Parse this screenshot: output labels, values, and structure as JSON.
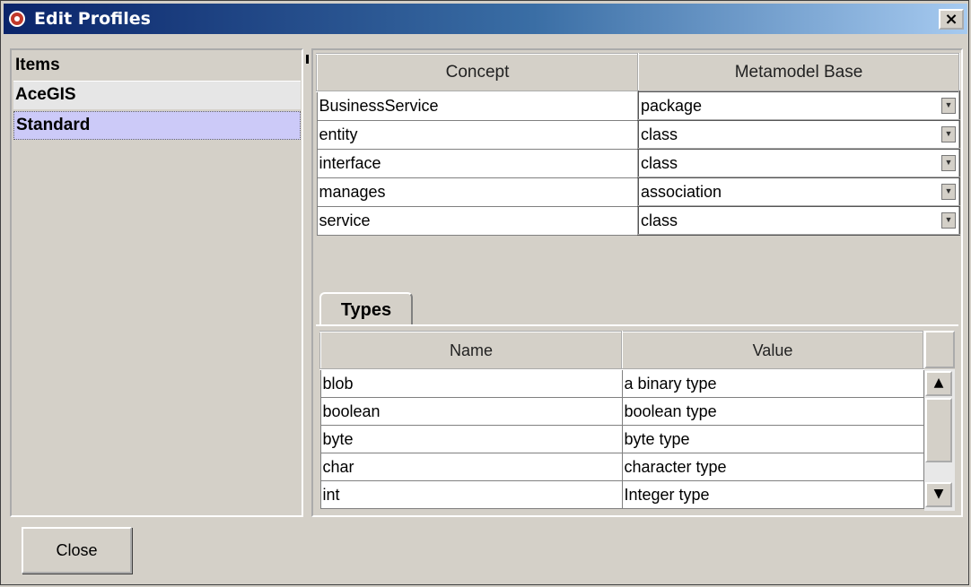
{
  "window": {
    "title": "Edit Profiles",
    "close_glyph": "×"
  },
  "items_panel": {
    "header": "Items",
    "items": [
      {
        "label": "AceGIS"
      },
      {
        "label": "Standard",
        "selected": true
      }
    ]
  },
  "concepts_table": {
    "columns": [
      "Concept",
      "Metamodel Base"
    ],
    "rows": [
      {
        "concept": "BusinessService",
        "base": "package"
      },
      {
        "concept": "entity",
        "base": "class"
      },
      {
        "concept": "interface",
        "base": "class"
      },
      {
        "concept": "manages",
        "base": "association"
      },
      {
        "concept": "service",
        "base": "class"
      }
    ]
  },
  "types_tab": {
    "label": "Types",
    "columns": [
      "Name",
      "Value"
    ],
    "rows": [
      {
        "name": "blob",
        "value": "a binary type"
      },
      {
        "name": "boolean",
        "value": "boolean type"
      },
      {
        "name": "byte",
        "value": "byte type"
      },
      {
        "name": "char",
        "value": "character type"
      },
      {
        "name": "int",
        "value": "Integer type"
      }
    ],
    "scroll_up_glyph": "▲",
    "scroll_down_glyph": "▼"
  },
  "footer": {
    "close_label": "Close"
  },
  "colors": {
    "titlebar_start": "#0a246a",
    "titlebar_end": "#a6caf0",
    "selected_item": "#cccaf8",
    "window_bg": "#d4d0c8"
  }
}
